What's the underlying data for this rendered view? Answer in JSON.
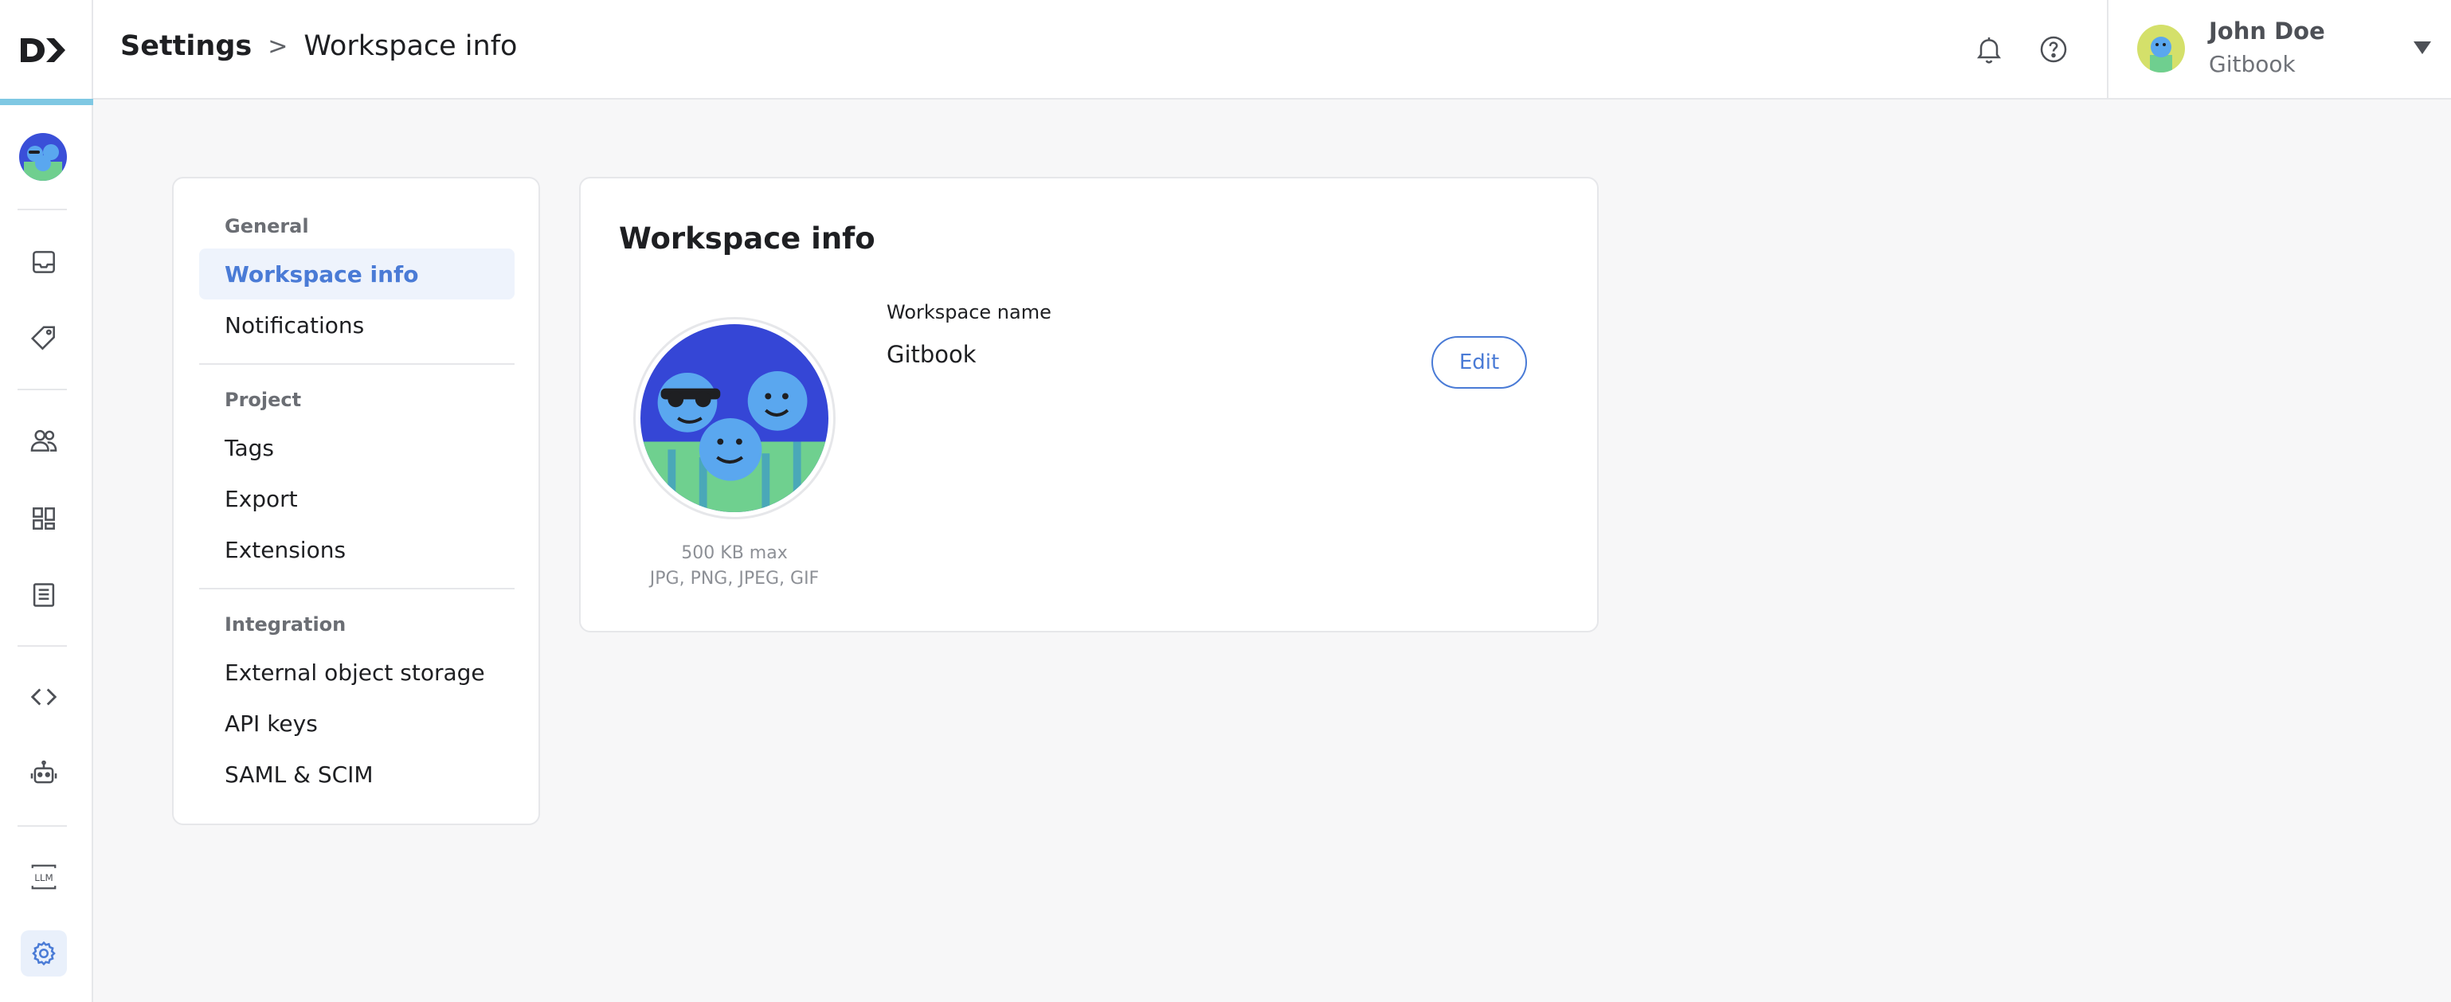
{
  "header": {
    "breadcrumb_root": "Settings",
    "breadcrumb_separator": ">",
    "breadcrumb_current": "Workspace info"
  },
  "user": {
    "name": "John Doe",
    "organization": "Gitbook"
  },
  "rail": {
    "icons": [
      "logo-icon",
      "workspace-avatar",
      "inbox-icon",
      "tag-icon",
      "users-icon",
      "dashboard-icon",
      "document-icon",
      "code-icon",
      "robot-icon",
      "llm-icon",
      "gear-icon"
    ],
    "llm_label": "LLM",
    "accent_bar_color": "#7fc8e3"
  },
  "settings_nav": {
    "groups": [
      {
        "title": "General",
        "items": [
          "Workspace info",
          "Notifications"
        ]
      },
      {
        "title": "Project",
        "items": [
          "Tags",
          "Export",
          "Extensions"
        ]
      },
      {
        "title": "Integration",
        "items": [
          "External object storage",
          "API keys",
          "SAML & SCIM"
        ]
      }
    ],
    "active_item": "Workspace info"
  },
  "workspace_card": {
    "title": "Workspace info",
    "image_hint_size": "500 KB max",
    "image_hint_types": "JPG, PNG, JPEG, GIF",
    "field_label": "Workspace name",
    "field_value": "Gitbook",
    "edit_label": "Edit"
  },
  "colors": {
    "accent": "#4a7bd6",
    "active_bg": "#eef3fc",
    "page_bg": "#f7f7f8",
    "border": "#e6e7ea"
  }
}
